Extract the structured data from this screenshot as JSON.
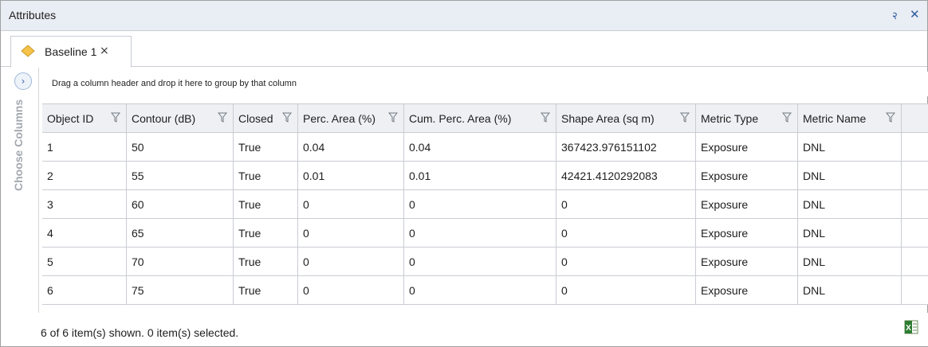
{
  "window": {
    "title": "Attributes"
  },
  "titlebar_buttons": {
    "pin_icon": "pin-icon",
    "close_icon": "close-icon",
    "pin_glyph": "२",
    "close_glyph": "✕"
  },
  "tab": {
    "label": "Baseline 1",
    "close_glyph": "×",
    "icon": "layer-diamond-icon"
  },
  "side_panel": {
    "label": "Choose Columns",
    "expand_glyph": "›"
  },
  "group_panel": {
    "hint": "Drag a column header and drop it here to group by that column"
  },
  "table": {
    "columns": [
      "Object ID",
      "Contour (dB)",
      "Closed",
      "Perc. Area (%)",
      "Cum. Perc. Area (%)",
      "Shape Area (sq m)",
      "Metric Type",
      "Metric Name"
    ],
    "rows": [
      [
        "1",
        "50",
        "True",
        "0.04",
        "0.04",
        "367423.976151102",
        "Exposure",
        "DNL"
      ],
      [
        "2",
        "55",
        "True",
        "0.01",
        "0.01",
        "42421.4120292083",
        "Exposure",
        "DNL"
      ],
      [
        "3",
        "60",
        "True",
        "0",
        "0",
        "0",
        "Exposure",
        "DNL"
      ],
      [
        "4",
        "65",
        "True",
        "0",
        "0",
        "0",
        "Exposure",
        "DNL"
      ],
      [
        "5",
        "70",
        "True",
        "0",
        "0",
        "0",
        "Exposure",
        "DNL"
      ],
      [
        "6",
        "75",
        "True",
        "0",
        "0",
        "0",
        "Exposure",
        "DNL"
      ]
    ]
  },
  "status": {
    "text": "6 of 6 item(s) shown. 0 item(s) selected.",
    "export_icon": "excel-export-icon"
  },
  "colors": {
    "accent": "#2f5a9c",
    "header_bg": "#eef0f4",
    "grid_line": "#c9ccd2",
    "tab_icon": "#f5c24a"
  }
}
